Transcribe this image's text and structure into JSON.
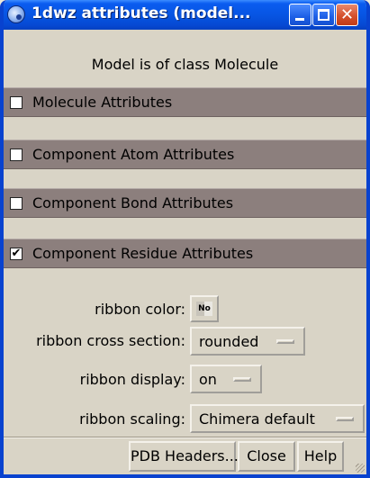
{
  "window": {
    "title": "1dwz attributes (model...",
    "minimize_icon": "minimize-icon",
    "maximize_icon": "maximize-icon",
    "close_icon": "close-icon",
    "close_glyph": "✕"
  },
  "model_class_text": "Model is of class Molecule",
  "sections": [
    {
      "label": "Molecule Attributes",
      "checked": false,
      "mark": ""
    },
    {
      "label": "Component Atom Attributes",
      "checked": false,
      "mark": ""
    },
    {
      "label": "Component Bond Attributes",
      "checked": false,
      "mark": ""
    },
    {
      "label": "Component Residue Attributes",
      "checked": true,
      "mark": "✔"
    }
  ],
  "residue_attributes": {
    "ribbon_color": {
      "label": "ribbon color:",
      "value": "No"
    },
    "ribbon_cross_section": {
      "label": "ribbon cross section:",
      "value": "rounded"
    },
    "ribbon_display": {
      "label": "ribbon display:",
      "value": "on"
    },
    "ribbon_scaling": {
      "label": "ribbon scaling:",
      "value": "Chimera default"
    }
  },
  "buttons": {
    "pdb_headers": "PDB Headers...",
    "close": "Close",
    "help": "Help"
  }
}
